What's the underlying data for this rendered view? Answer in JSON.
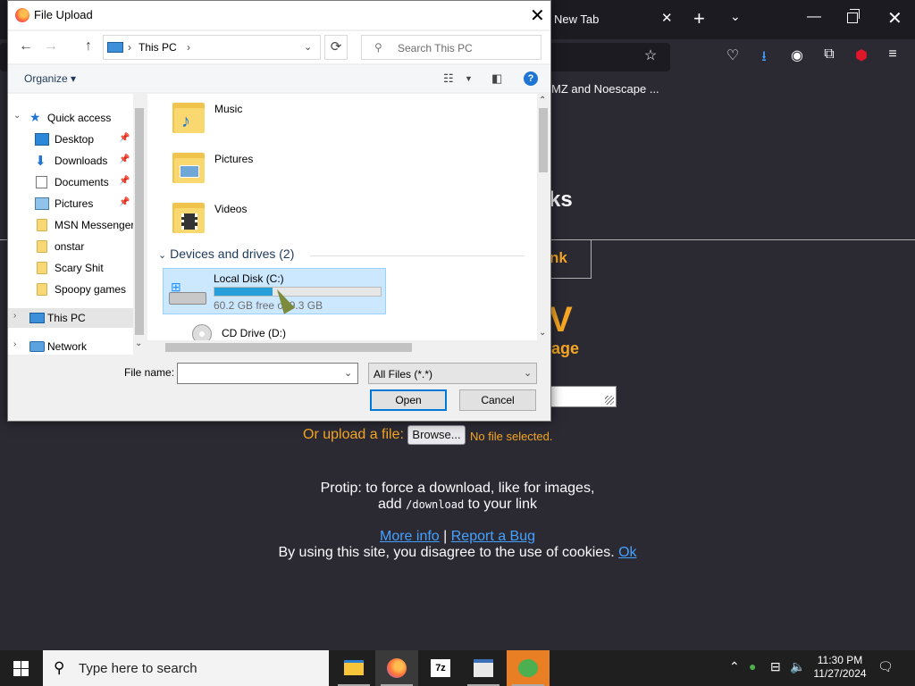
{
  "browser": {
    "tab_title": "New Tab",
    "tab_close": "✕",
    "new_tab": "+",
    "tab_list": "⌄",
    "minimize": "—",
    "close": "✕",
    "bookmark_partial": "MZ and Noescape ...",
    "heading_partial": "ks",
    "box_partial": "nk",
    "big_partial": "V",
    "sub_partial": "age",
    "upload_label": "Or upload a file:",
    "browse_label": "Browse...",
    "no_file": "No file selected.",
    "protip_line1": "Protip: to force a download, like for images,",
    "protip_line2_pre": "add ",
    "protip_code": "/download",
    "protip_line2_post": " to your link",
    "more_info": "More info",
    "link_sep": " | ",
    "report_bug": "Report a Bug",
    "cookie_text": "By using this site, you disagree to the use of cookies. ",
    "cookie_ok": "Ok"
  },
  "dialog": {
    "title": "File Upload",
    "close_label": "✕",
    "address": {
      "path": "This PC",
      "sep": "›"
    },
    "search_placeholder": "Search This PC",
    "organize_label": "Organize",
    "help_label": "?",
    "nav": [
      {
        "label": "Quick access"
      },
      {
        "label": "Desktop"
      },
      {
        "label": "Downloads"
      },
      {
        "label": "Documents"
      },
      {
        "label": "Pictures"
      },
      {
        "label": "MSN Messenger"
      },
      {
        "label": "onstar"
      },
      {
        "label": "Scary Shit"
      },
      {
        "label": "Spoopy games"
      },
      {
        "label": "This PC"
      },
      {
        "label": "Network"
      }
    ],
    "folders": [
      {
        "label": "Music"
      },
      {
        "label": "Pictures"
      },
      {
        "label": "Videos"
      }
    ],
    "devices_heading": "Devices and drives (2)",
    "drives": [
      {
        "name": "Local Disk (C:)",
        "free_text": "60.2 GB free of 9.3 GB",
        "used_fraction": 0.35
      },
      {
        "name": "CD Drive (D:)"
      }
    ],
    "file_name_label": "File name:",
    "file_name_value": "",
    "file_type": "All Files (*.*)",
    "open_label": "Open",
    "cancel_label": "Cancel"
  },
  "taskbar": {
    "search_placeholder": "Type here to search",
    "time": "11:30 PM",
    "date": "11/27/2024"
  }
}
